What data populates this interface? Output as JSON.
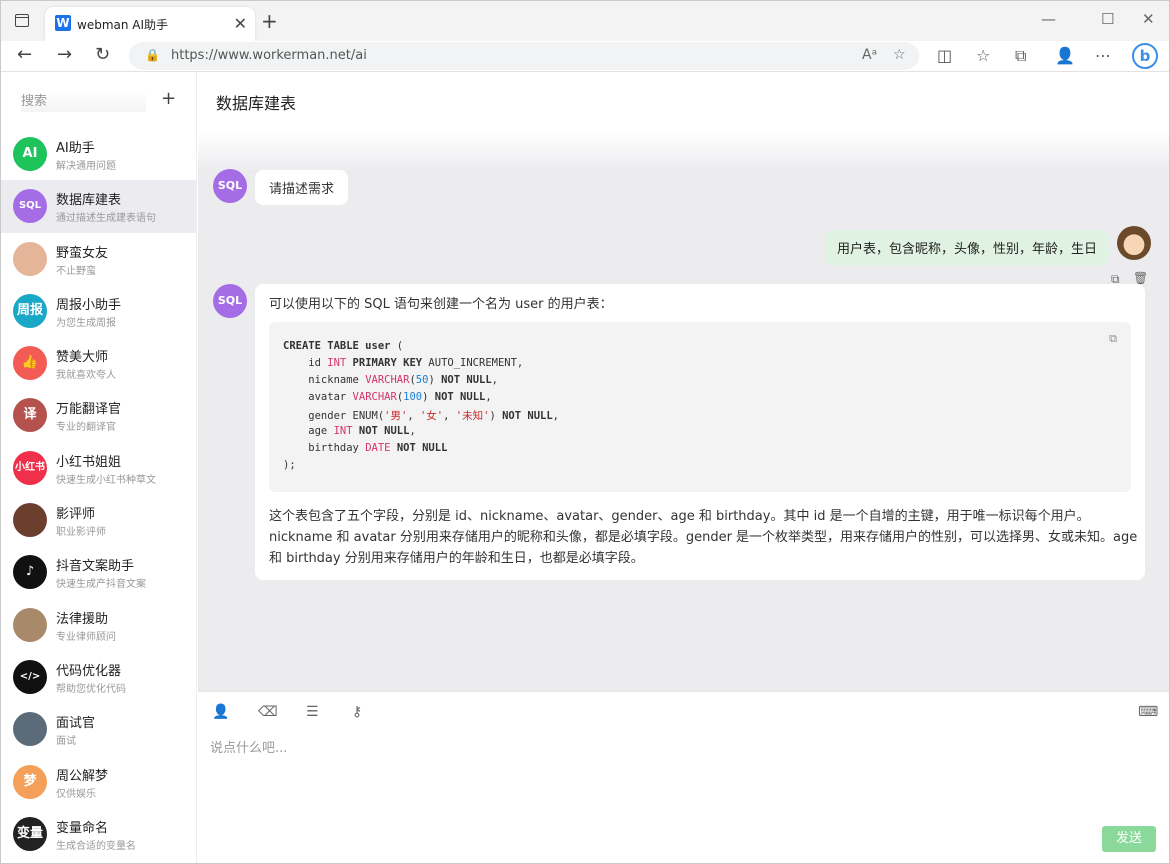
{
  "browser": {
    "tab_title": "webman AI助手",
    "tab_fav": "W",
    "close_glyph": "✕",
    "newtab_glyph": "+",
    "url": "https://www.workerman.net/ai",
    "win_min": "—",
    "win_max": "☐",
    "win_close": "✕"
  },
  "sidebar": {
    "search_placeholder": "搜索",
    "add_glyph": "+",
    "items": [
      {
        "name": "AI助手",
        "desc": "解决通用问题",
        "avatar": "AI",
        "color": "#1ec35c"
      },
      {
        "name": "数据库建表",
        "desc": "通过描述生成建表语句",
        "avatar": "SQL",
        "color": "#a46de6"
      },
      {
        "name": "野蛮女友",
        "desc": "不止野蛮",
        "avatar": "",
        "color": "#e5b59a"
      },
      {
        "name": "周报小助手",
        "desc": "为您生成周报",
        "avatar": "周报",
        "color": "#1aa8c7"
      },
      {
        "name": "赞美大师",
        "desc": "我就喜欢夸人",
        "avatar": "👍",
        "color": "#f25c54"
      },
      {
        "name": "万能翻译官",
        "desc": "专业的翻译官",
        "avatar": "译",
        "color": "#b5524e"
      },
      {
        "name": "小红书姐姐",
        "desc": "快速生成小红书种草文",
        "avatar": "小红书",
        "color": "#f0304a"
      },
      {
        "name": "影评师",
        "desc": "职业影评师",
        "avatar": "",
        "color": "#6b3e2e"
      },
      {
        "name": "抖音文案助手",
        "desc": "快速生成产抖音文案",
        "avatar": "♪",
        "color": "#111111"
      },
      {
        "name": "法律援助",
        "desc": "专业律师顾问",
        "avatar": "",
        "color": "#a88a6a"
      },
      {
        "name": "代码优化器",
        "desc": "帮助您优化代码",
        "avatar": "</>",
        "color": "#111111"
      },
      {
        "name": "面试官",
        "desc": "面试",
        "avatar": "",
        "color": "#5b6b7a"
      },
      {
        "name": "周公解梦",
        "desc": "仅供娱乐",
        "avatar": "梦",
        "color": "#f5a05a"
      },
      {
        "name": "变量命名",
        "desc": "生成合适的变量名",
        "avatar": "变量",
        "color": "#222222"
      }
    ]
  },
  "chat": {
    "title": "数据库建表",
    "bot_avatar": "SQL",
    "bot_greeting": "请描述需求",
    "user_message": "用户表，包含昵称，头像，性别，年龄，生日",
    "reply_intro": "可以使用以下的 SQL 语句来创建一个名为 user 的用户表：",
    "code_lines": [
      [
        {
          "t": "CREATE TABLE user ",
          "c": "kw"
        },
        {
          "t": "(",
          "c": ""
        }
      ],
      [
        {
          "t": "    id ",
          "c": ""
        },
        {
          "t": "INT",
          "c": "ty"
        },
        {
          "t": " PRIMARY KEY ",
          "c": "kw"
        },
        {
          "t": "AUTO_INCREMENT,",
          "c": ""
        }
      ],
      [
        {
          "t": "    nickname ",
          "c": ""
        },
        {
          "t": "VARCHAR",
          "c": "ty"
        },
        {
          "t": "(",
          "c": ""
        },
        {
          "t": "50",
          "c": "nu"
        },
        {
          "t": ") ",
          "c": ""
        },
        {
          "t": "NOT NULL",
          "c": "kw"
        },
        {
          "t": ",",
          "c": ""
        }
      ],
      [
        {
          "t": "    avatar ",
          "c": ""
        },
        {
          "t": "VARCHAR",
          "c": "ty"
        },
        {
          "t": "(",
          "c": ""
        },
        {
          "t": "100",
          "c": "nu"
        },
        {
          "t": ") ",
          "c": ""
        },
        {
          "t": "NOT NULL",
          "c": "kw"
        },
        {
          "t": ",",
          "c": ""
        }
      ],
      [
        {
          "t": "    gender ENUM(",
          "c": ""
        },
        {
          "t": "'男'",
          "c": "st"
        },
        {
          "t": ", ",
          "c": ""
        },
        {
          "t": "'女'",
          "c": "st"
        },
        {
          "t": ", ",
          "c": ""
        },
        {
          "t": "'未知'",
          "c": "st"
        },
        {
          "t": ") ",
          "c": ""
        },
        {
          "t": "NOT NULL",
          "c": "kw"
        },
        {
          "t": ",",
          "c": ""
        }
      ],
      [
        {
          "t": "    age ",
          "c": ""
        },
        {
          "t": "INT",
          "c": "ty"
        },
        {
          "t": " ",
          "c": ""
        },
        {
          "t": "NOT NULL",
          "c": "kw"
        },
        {
          "t": ",",
          "c": ""
        }
      ],
      [
        {
          "t": "    birthday ",
          "c": ""
        },
        {
          "t": "DATE",
          "c": "ty"
        },
        {
          "t": " ",
          "c": ""
        },
        {
          "t": "NOT NULL",
          "c": "kw"
        }
      ],
      [
        {
          "t": ");",
          "c": ""
        }
      ]
    ],
    "reply_outro": "这个表包含了五个字段，分别是 id、nickname、avatar、gender、age 和 birthday。其中 id 是一个自增的主键，用于唯一标识每个用户。nickname 和 avatar 分别用来存储用户的昵称和头像，都是必填字段。gender 是一个枚举类型，用来存储用户的性别，可以选择男、女或未知。age 和 birthday 分别用来存储用户的年龄和生日，也都是必填字段。",
    "copy_glyph": "⧉",
    "delete_glyph": "🗑"
  },
  "composer": {
    "placeholder": "说点什么吧...",
    "send_label": "发送"
  }
}
